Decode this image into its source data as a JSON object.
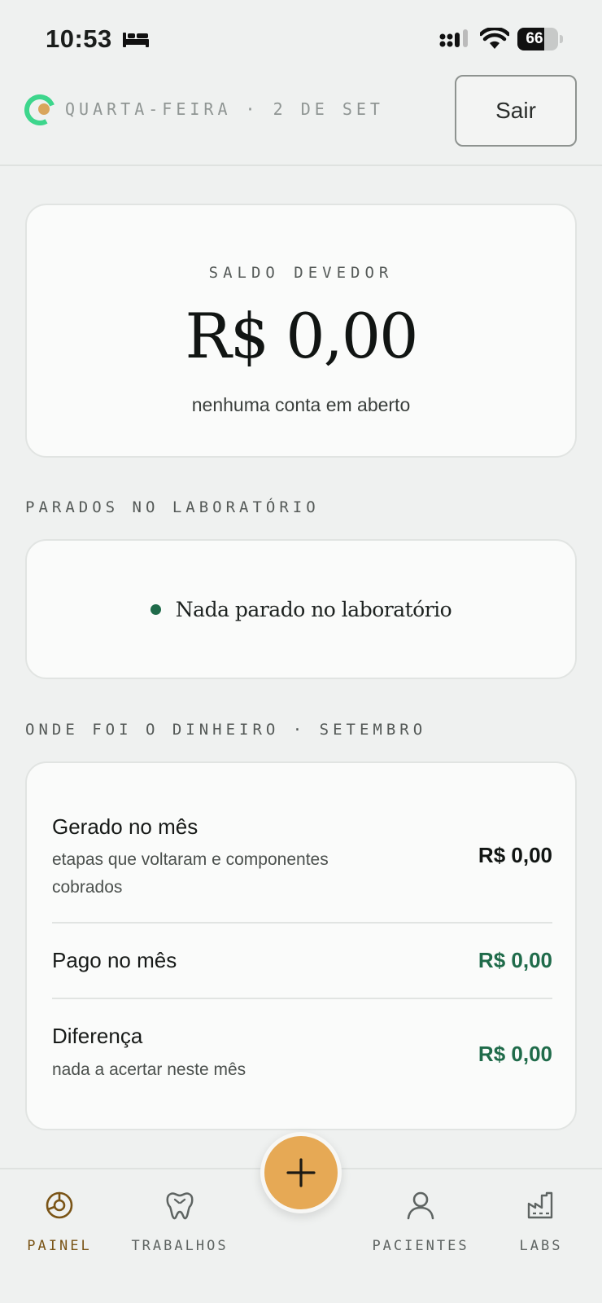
{
  "status_bar": {
    "time": "10:53",
    "battery": "66",
    "battery_level": 0.66
  },
  "header": {
    "date": "QUARTA-FEIRA · 2 DE SET",
    "logout_label": "Sair"
  },
  "balance": {
    "label": "SALDO DEVEDOR",
    "amount": "R$ 0,00",
    "subtitle": "nenhuma conta em aberto"
  },
  "lab_section": {
    "title": "PARADOS NO LABORATÓRIO",
    "status": "Nada parado no laboratório"
  },
  "money_section": {
    "title": "ONDE FOI O DINHEIRO · SETEMBRO",
    "rows": [
      {
        "label": "Gerado no mês",
        "description": "etapas que voltaram e componentes cobrados",
        "value": "R$ 0,00",
        "color": "#111513"
      },
      {
        "label": "Pago no mês",
        "description": "",
        "value": "R$ 0,00",
        "color": "#1f6b4a"
      },
      {
        "label": "Diferença",
        "description": "nada a acertar neste mês",
        "value": "R$ 0,00",
        "color": "#1f6b4a"
      }
    ]
  },
  "nav": {
    "items": [
      {
        "label": "PAINEL",
        "icon": "dashboard-icon",
        "active": true
      },
      {
        "label": "TRABALHOS",
        "icon": "tooth-icon",
        "active": false
      },
      {
        "label": "PACIENTES",
        "icon": "person-icon",
        "active": false
      },
      {
        "label": "LABS",
        "icon": "factory-icon",
        "active": false
      }
    ],
    "fab_icon": "plus-icon"
  },
  "colors": {
    "background": "#eff1f0",
    "accent_green": "#1f6b4a",
    "fab": "#e6a955",
    "active_nav": "#7a5416"
  }
}
